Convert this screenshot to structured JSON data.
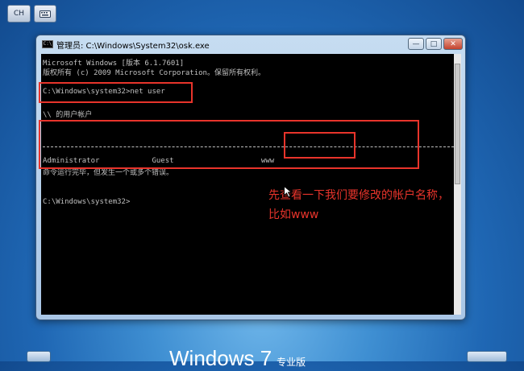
{
  "topbar": {
    "language_label": "CH",
    "keyboard_icon": "keyboard-icon"
  },
  "window": {
    "title": "管理员: C:\\Windows\\System32\\osk.exe",
    "icon": "cmd-icon",
    "icon_label": "C:\\",
    "controls": {
      "minimize": "—",
      "maximize": "□",
      "close": "✕"
    }
  },
  "console": {
    "lines": [
      "Microsoft Windows [版本 6.1.7601]",
      "版权所有 (c) 2009 Microsoft Corporation。保留所有权利。",
      "",
      "C:\\Windows\\system32>net user",
      "",
      "\\\\ 的用户帐户",
      "",
      "Administrator            Guest                    www",
      "命令运行完毕，但发生一个或多个错误。",
      "",
      "C:\\Windows\\system32>"
    ]
  },
  "annotation": {
    "line1": "先查看一下我们要修改的帐户名称，",
    "line2": "比如www"
  },
  "bottom": {
    "logo_text": "Windows 7",
    "edition": "专业版"
  },
  "colors": {
    "highlight": "#e8342b",
    "console_text": "#c0c0c0",
    "console_bg": "#000000"
  }
}
